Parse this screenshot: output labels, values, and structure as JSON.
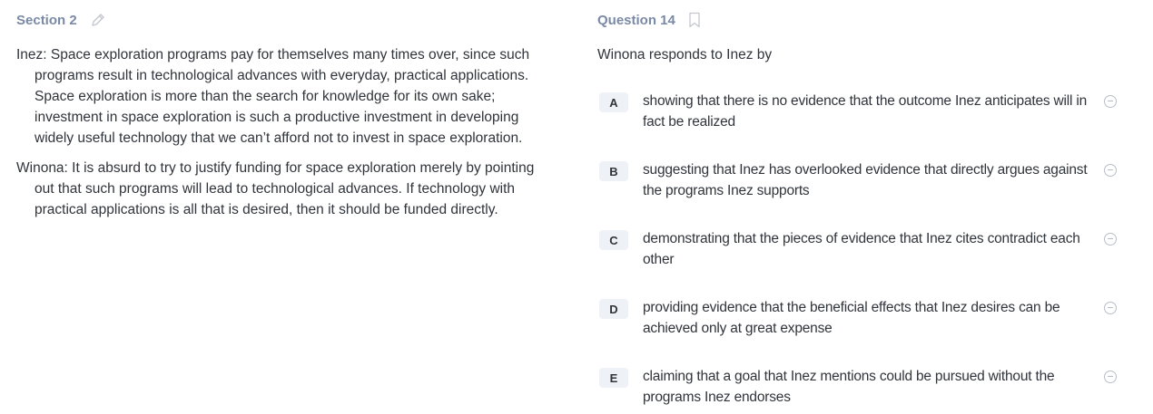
{
  "section": {
    "title": "Section 2",
    "edit_icon": "pencil-icon"
  },
  "passage": {
    "paragraphs": [
      "Inez: Space exploration programs pay for themselves many times over, since such programs result in technological advances with everyday, practical applications. Space exploration is more than the search for knowledge for its own sake; investment in space exploration is such a productive investment in developing widely useful technology that we can’t afford not to invest in space exploration.",
      "Winona: It is absurd to try to justify funding for space exploration merely by pointing out that such programs will lead to technological advances. If technology with practical applications is all that is desired, then it should be funded directly."
    ]
  },
  "question": {
    "title": "Question 14",
    "bookmark_icon": "bookmark-icon",
    "stem": "Winona responds to Inez by",
    "choices": [
      {
        "letter": "A",
        "text": "showing that there is no evidence that the outcome Inez anticipates will in fact be realized"
      },
      {
        "letter": "B",
        "text": "suggesting that Inez has overlooked evidence that directly argues against the programs Inez supports"
      },
      {
        "letter": "C",
        "text": "demonstrating that the pieces of evidence that Inez cites contradict each other"
      },
      {
        "letter": "D",
        "text": "providing evidence that the beneficial effects that Inez desires can be achieved only at great expense"
      },
      {
        "letter": "E",
        "text": "claiming that a goal that Inez mentions could be pursued without the programs Inez endorses"
      }
    ]
  }
}
